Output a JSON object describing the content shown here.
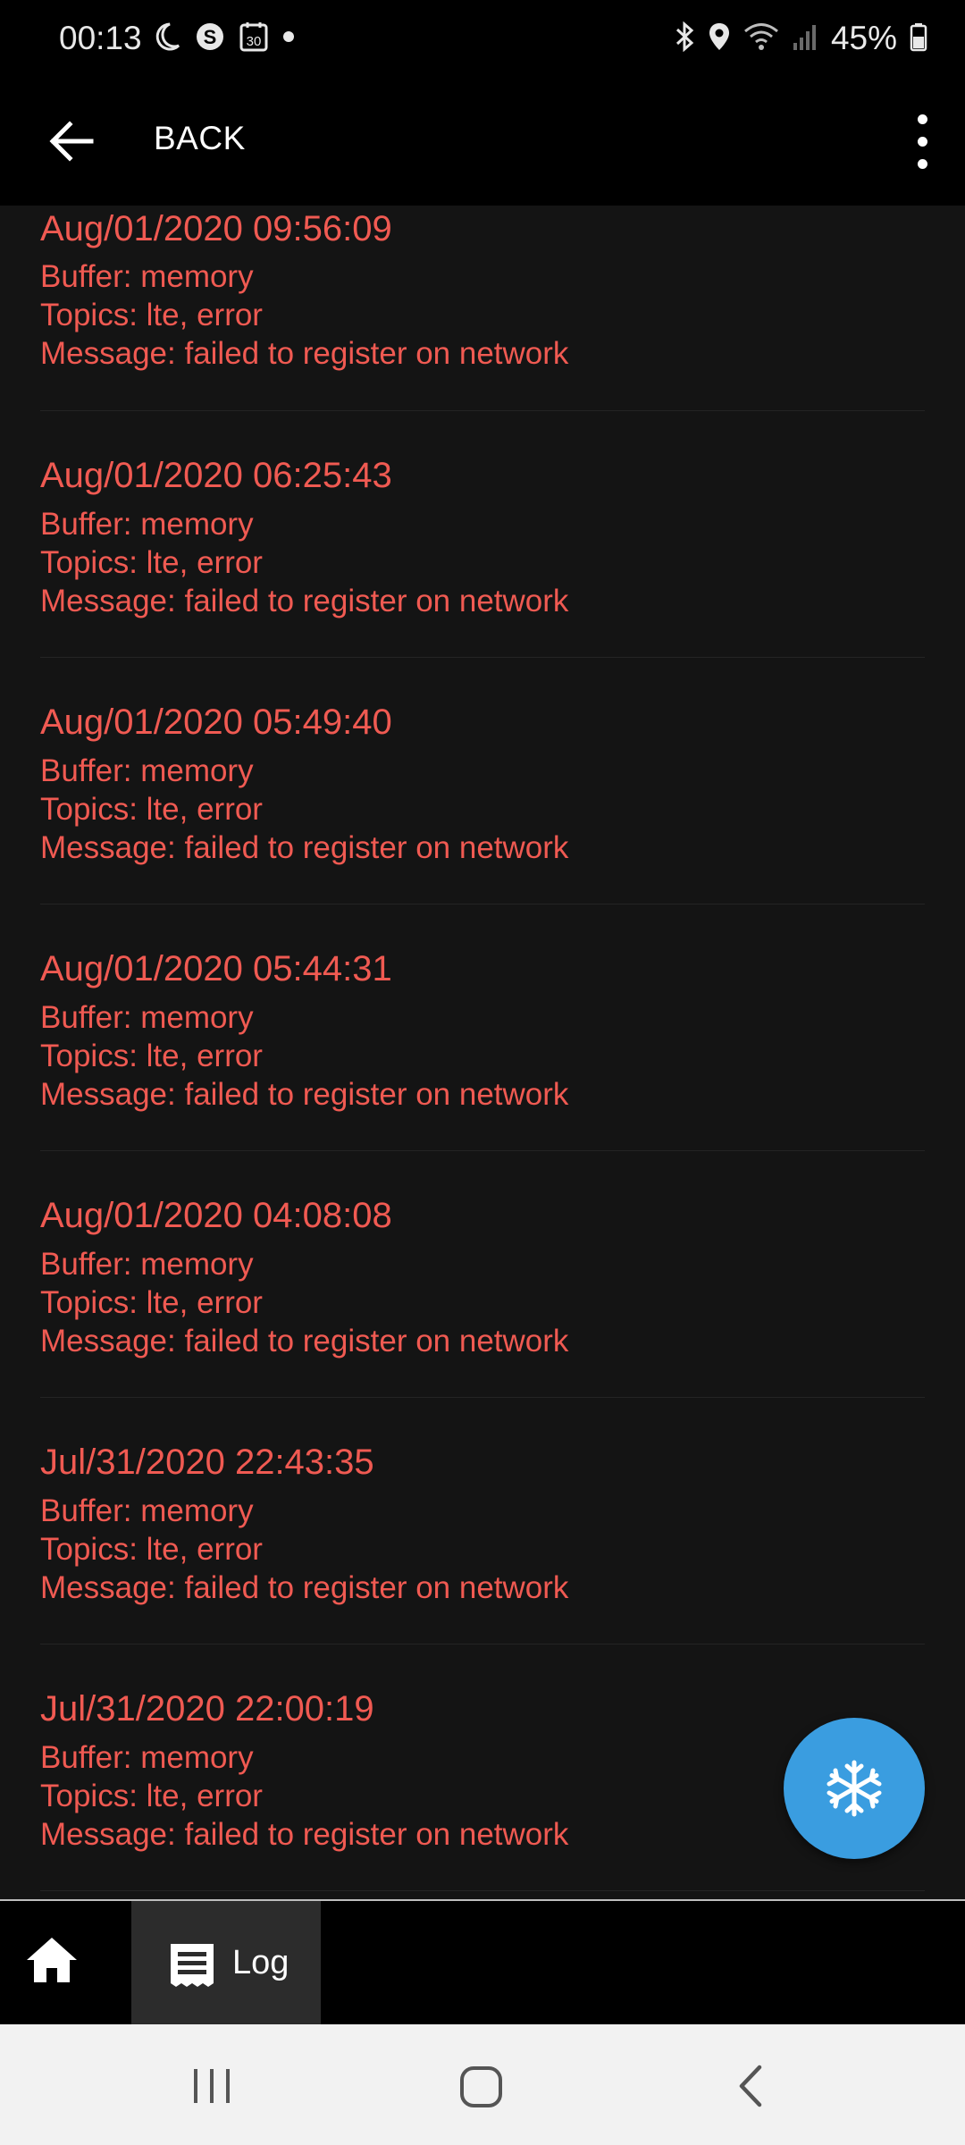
{
  "status_bar": {
    "time": "00:13",
    "battery_percent": "45%",
    "left_icons": [
      "moon-icon",
      "s-badge-icon",
      "calendar-30-icon",
      "dot-icon"
    ],
    "calendar_day": "30",
    "right_icons": [
      "bluetooth-icon",
      "location-icon",
      "wifi-icon",
      "signal-icon",
      "battery-icon"
    ]
  },
  "app_bar": {
    "back_label": "BACK"
  },
  "log_entries": [
    {
      "date": "Aug/01/2020 09:56:09",
      "buffer": "Buffer: memory",
      "topics": "Topics: lte, error",
      "message": "Message: failed to register on network"
    },
    {
      "date": "Aug/01/2020 06:25:43",
      "buffer": "Buffer: memory",
      "topics": "Topics: lte, error",
      "message": "Message: failed to register on network"
    },
    {
      "date": "Aug/01/2020 05:49:40",
      "buffer": "Buffer: memory",
      "topics": "Topics: lte, error",
      "message": "Message: failed to register on network"
    },
    {
      "date": "Aug/01/2020 05:44:31",
      "buffer": "Buffer: memory",
      "topics": "Topics: lte, error",
      "message": "Message: failed to register on network"
    },
    {
      "date": "Aug/01/2020 04:08:08",
      "buffer": "Buffer: memory",
      "topics": "Topics: lte, error",
      "message": "Message: failed to register on network"
    },
    {
      "date": "Jul/31/2020 22:43:35",
      "buffer": "Buffer: memory",
      "topics": "Topics: lte, error",
      "message": "Message: failed to register on network"
    },
    {
      "date": "Jul/31/2020 22:00:19",
      "buffer": "Buffer: memory",
      "topics": "Topics: lte, error",
      "message": "Message: failed to register on network"
    }
  ],
  "fab": {
    "icon": "snowflake-icon"
  },
  "tab_bar": {
    "tabs": [
      {
        "icon": "home-icon",
        "label": ""
      },
      {
        "icon": "log-list-icon",
        "label": "Log",
        "active": true
      }
    ]
  },
  "colors": {
    "log_text": "#f05a52",
    "fab": "#3a9de0",
    "background": "#141414"
  }
}
